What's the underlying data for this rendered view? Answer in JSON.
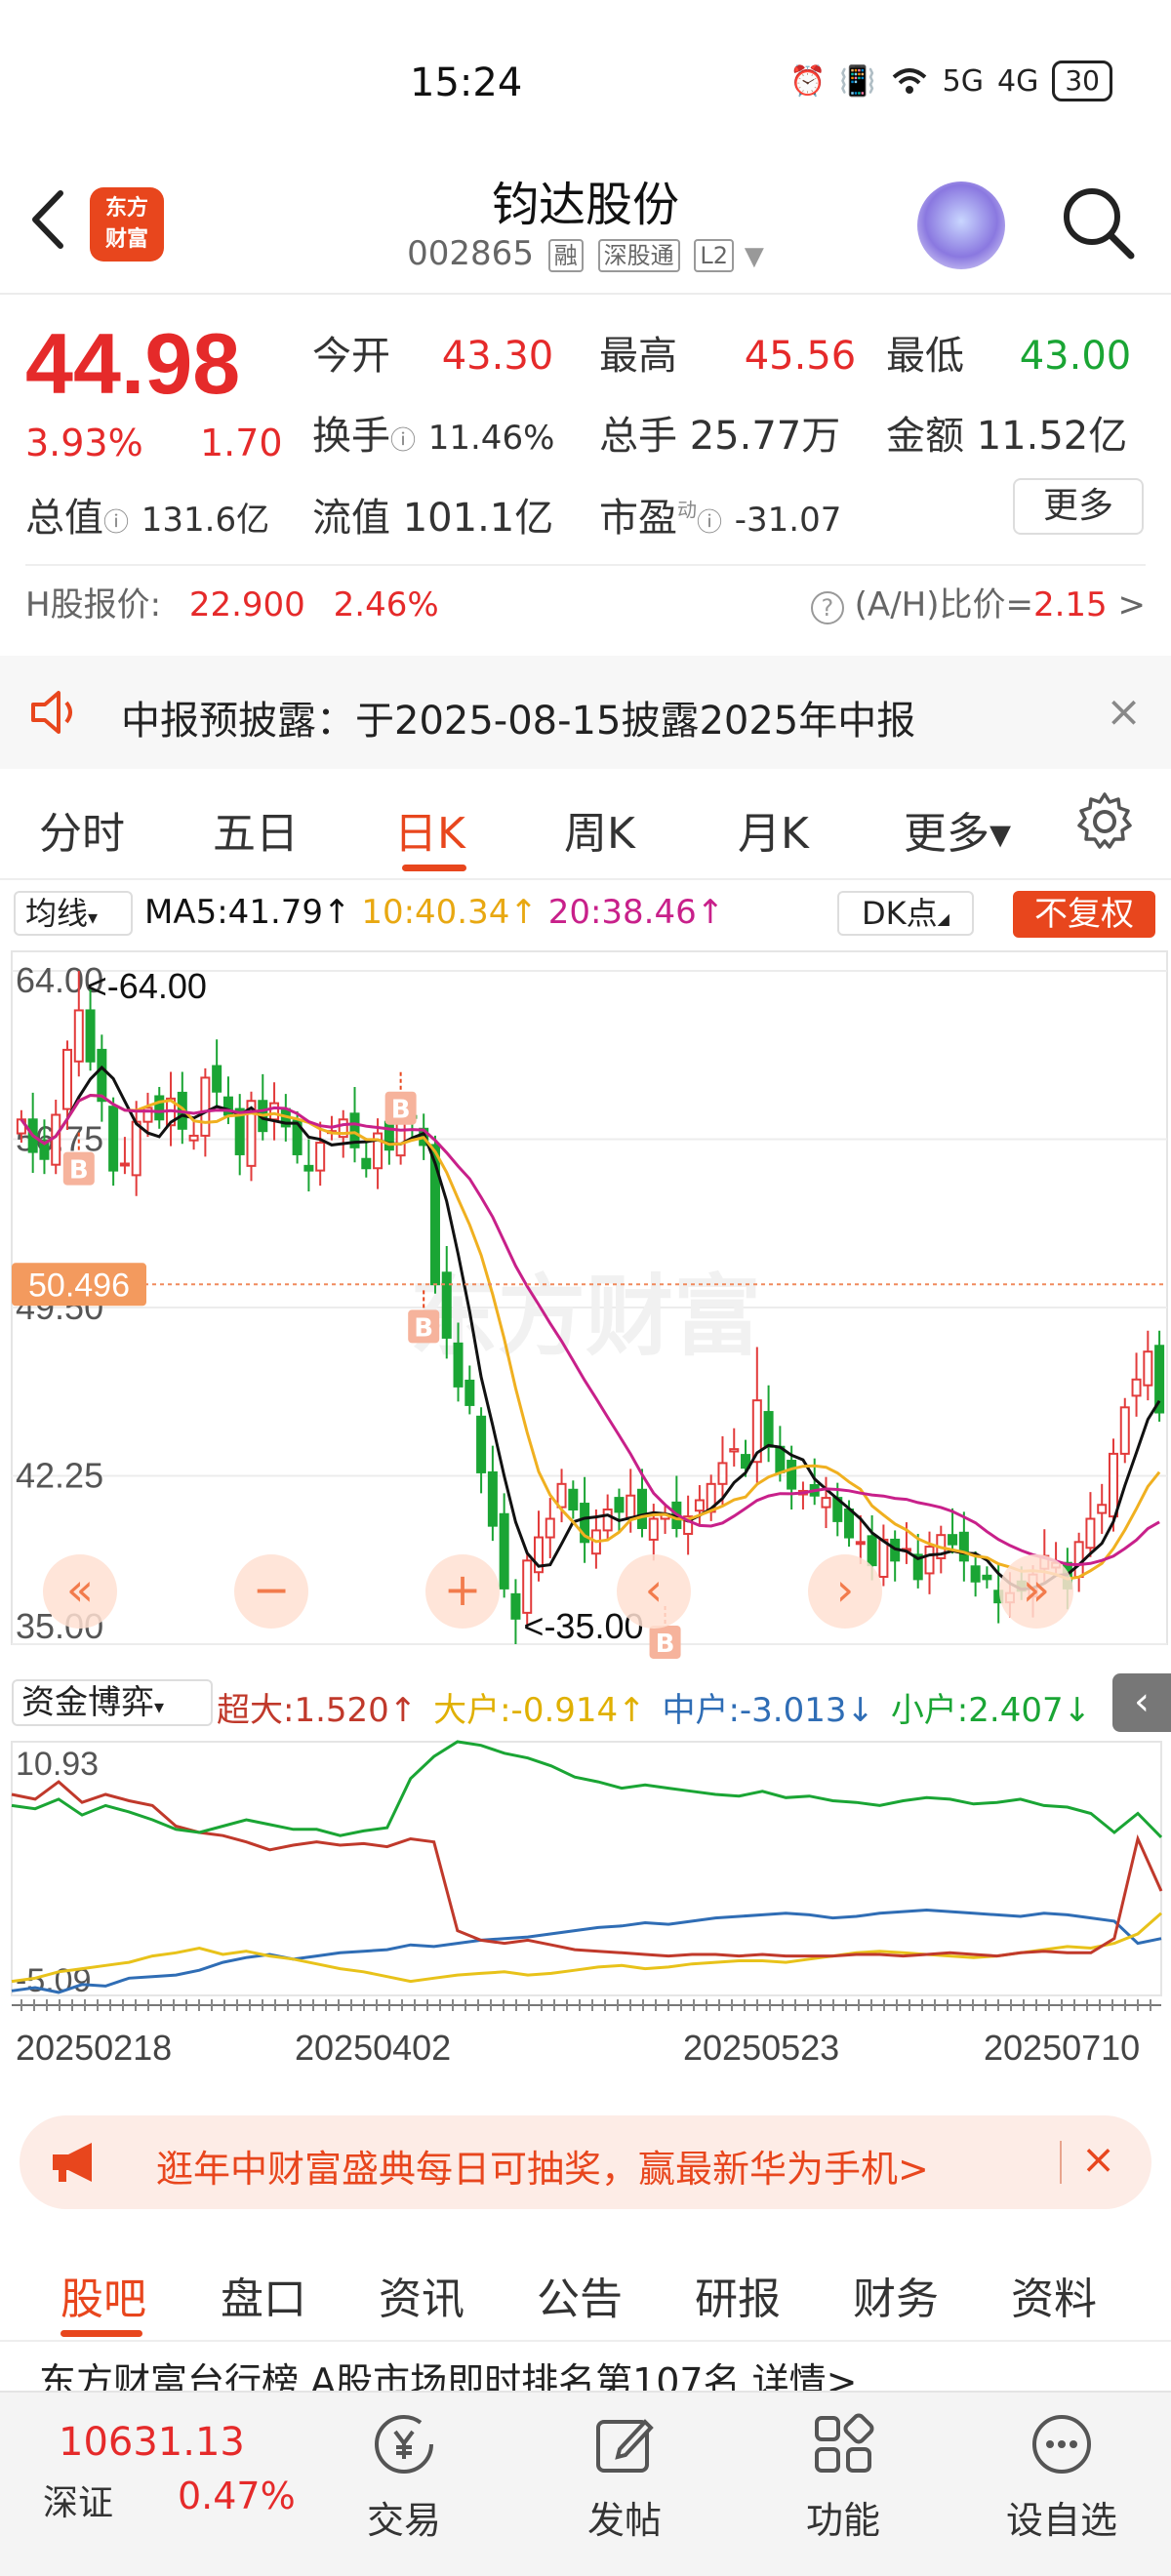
{
  "status_bar": {
    "time": "15:24",
    "signal1": "5G",
    "signal2": "4G",
    "battery": "30"
  },
  "header": {
    "logo_line1": "东方",
    "logo_line2": "财富",
    "stock_name": "钧达股份",
    "stock_code": "002865",
    "tags": [
      "融",
      "深股通",
      "L2"
    ]
  },
  "quote": {
    "price": "44.98",
    "change_pct": "3.93%",
    "change_amt": "1.70",
    "open_label": "今开",
    "open": "43.30",
    "high_label": "最高",
    "high": "45.56",
    "low_label": "最低",
    "low": "43.00",
    "turnover_label": "换手",
    "turnover": "11.46%",
    "volume_label": "总手",
    "volume": "25.77万",
    "amount_label": "金额",
    "amount": "11.52亿",
    "mktcap_label": "总值",
    "mktcap": "131.6亿",
    "float_label": "流值",
    "float": "101.1亿",
    "pe_label": "市盈",
    "pe_sup": "动",
    "pe": "-31.07",
    "more_label": "更多",
    "h_label": "H股报价:",
    "h_price": "22.900",
    "h_pct": "2.46%",
    "ah_label": "(A/H)比价=",
    "ah_value": "2.15",
    "ah_arrow": ">"
  },
  "notice": {
    "text": "中报预披露：于2025-08-15披露2025年中报",
    "close": "×"
  },
  "tabs": [
    "分时",
    "五日",
    "日K",
    "周K",
    "月K",
    "更多▾"
  ],
  "ma_row": {
    "select": "均线",
    "ma5": "MA5:41.79↑",
    "ma10": "10:40.34↑",
    "ma20": "20:38.46↑",
    "dk": "DK点",
    "fq": "不复权"
  },
  "kchart": {
    "y_labels": [
      "64.00",
      "56.75",
      "49.50",
      "42.25",
      "35.00"
    ],
    "y_values": [
      64.0,
      56.75,
      49.5,
      42.25,
      35.0
    ],
    "max_label": "<-64.00",
    "min_label": "<-35.00",
    "cursor_value": "50.496",
    "watermark": "东方财富",
    "marker": "B"
  },
  "chart_data": {
    "type": "candlestick",
    "ylim": [
      35.0,
      64.0
    ],
    "ma_colors": {
      "ma5": "#111111",
      "ma10": "#f0b020",
      "ma20": "#c8208a"
    },
    "candle_closes": [
      57.6,
      56.2,
      55.9,
      57.8,
      60.6,
      62.3,
      60.1,
      58.4,
      55.4,
      55.7,
      57.5,
      58.1,
      57.6,
      58.5,
      57.2,
      56.9,
      59.4,
      58.8,
      57.8,
      56.1,
      58.4,
      57.1,
      58.3,
      57.3,
      56.1,
      55.4,
      56.6,
      57.1,
      57.6,
      56.4,
      55.5,
      57.0,
      56.3,
      57.5,
      57.7,
      56.5,
      50.5,
      48.2,
      46.1,
      45.3,
      42.4,
      40.1,
      37.4,
      36.1,
      38.6,
      39.6,
      40.4,
      41.9,
      40.8,
      39.4,
      39.9,
      40.8,
      40.7,
      41.4,
      40.0,
      40.4,
      40.6,
      40.0,
      40.5,
      41.2,
      41.9,
      42.8,
      43.4,
      42.6,
      45.5,
      43.5,
      42.4,
      41.7,
      41.6,
      41.4,
      41.3,
      40.3,
      39.6,
      39.4,
      38.4,
      39.5,
      38.6,
      39.1,
      37.8,
      39.2,
      39.7,
      39.3,
      38.6,
      37.7,
      37.8,
      36.8,
      37.2,
      37.3,
      38.0,
      38.8,
      38.5,
      37.4,
      39.4,
      40.4,
      41.0,
      43.2,
      45.2,
      46.4,
      47.6,
      44.98
    ]
  },
  "fund_row": {
    "select": "资金博弈",
    "super": "超大:1.520↑",
    "big": "大户:-0.914↑",
    "mid": "中户:-3.013↓",
    "small": "小户:2.407↓"
  },
  "fund_chart": {
    "y_top": "10.93",
    "y_bottom": "-5.09",
    "x_labels": [
      "20250218",
      "20250402",
      "20250523",
      "20250710"
    ],
    "series_colors": {
      "super": "#c0392b",
      "big": "#e8c21a",
      "mid": "#2f6db5",
      "small": "#1aa534"
    },
    "series": {
      "super": [
        7.6,
        7.3,
        8.4,
        7.1,
        7.6,
        7.2,
        6.9,
        5.6,
        5.2,
        5.0,
        4.6,
        4.1,
        4.4,
        4.6,
        4.4,
        4.5,
        4.3,
        4.8,
        4.6,
        -1.0,
        -1.6,
        -1.8,
        -1.6,
        -1.9,
        -2.2,
        -2.3,
        -2.4,
        -2.5,
        -2.6,
        -2.5,
        -2.5,
        -2.6,
        -2.5,
        -2.6,
        -2.6,
        -2.6,
        -2.5,
        -2.5,
        -2.6,
        -2.5,
        -2.4,
        -2.5,
        -2.6,
        -2.4,
        -2.3,
        -2.4,
        -2.4,
        -1.5,
        4.8,
        1.5
      ],
      "big": [
        -4.2,
        -4.0,
        -3.6,
        -3.4,
        -3.2,
        -3.0,
        -2.6,
        -2.4,
        -2.1,
        -2.5,
        -2.3,
        -2.6,
        -2.8,
        -3.1,
        -3.4,
        -3.6,
        -3.9,
        -4.2,
        -4.0,
        -3.8,
        -3.7,
        -3.6,
        -3.8,
        -3.7,
        -3.5,
        -3.3,
        -3.2,
        -3.4,
        -3.3,
        -3.1,
        -3.0,
        -2.9,
        -2.9,
        -3.0,
        -2.8,
        -2.6,
        -2.4,
        -2.3,
        -2.4,
        -2.5,
        -2.6,
        -2.7,
        -2.6,
        -2.4,
        -2.2,
        -2.0,
        -2.1,
        -1.8,
        -1.2,
        0.1
      ],
      "mid": [
        -4.8,
        -4.6,
        -4.9,
        -4.4,
        -4.5,
        -4.0,
        -3.9,
        -3.8,
        -3.5,
        -3.0,
        -2.7,
        -2.5,
        -2.8,
        -2.6,
        -2.4,
        -2.3,
        -2.2,
        -1.9,
        -2.0,
        -1.8,
        -1.6,
        -1.5,
        -1.4,
        -1.2,
        -1.0,
        -0.8,
        -0.7,
        -0.5,
        -0.6,
        -0.4,
        -0.2,
        -0.1,
        0.0,
        0.1,
        0.0,
        -0.2,
        -0.1,
        0.1,
        0.2,
        0.3,
        0.2,
        0.1,
        0.0,
        -0.1,
        0.1,
        0.0,
        -0.2,
        -0.4,
        -1.8,
        -1.5
      ],
      "small": [
        6.9,
        6.7,
        7.3,
        6.3,
        6.9,
        6.5,
        6.0,
        5.4,
        5.2,
        5.6,
        6.0,
        5.7,
        5.4,
        5.4,
        5.0,
        5.3,
        5.5,
        8.6,
        10.0,
        10.93,
        10.7,
        10.2,
        9.9,
        9.4,
        8.7,
        8.4,
        8.0,
        8.2,
        8.0,
        7.8,
        7.6,
        7.5,
        7.8,
        7.4,
        7.5,
        7.2,
        7.1,
        6.9,
        7.2,
        7.4,
        7.3,
        7.0,
        7.1,
        7.3,
        6.9,
        6.8,
        6.4,
        5.2,
        6.4,
        4.9
      ]
    }
  },
  "banner": {
    "text": "逛年中财富盛典每日可抽奖，赢最新华为手机>",
    "close": "×"
  },
  "bottom_tabs": [
    "股吧",
    "盘口",
    "资讯",
    "公告",
    "研报",
    "财务",
    "资料"
  ],
  "peek_text": "东方财富台行榜 A股市场即时排名第107名 详情>",
  "bottom_nav": {
    "index_value": "10631.13",
    "index_name": "深证",
    "index_pct": "0.47%",
    "items": [
      {
        "label": "交易",
        "icon": "yen-icon"
      },
      {
        "label": "发帖",
        "icon": "edit-icon"
      },
      {
        "label": "功能",
        "icon": "grid-icon"
      },
      {
        "label": "设自选",
        "icon": "more-icon"
      }
    ]
  }
}
